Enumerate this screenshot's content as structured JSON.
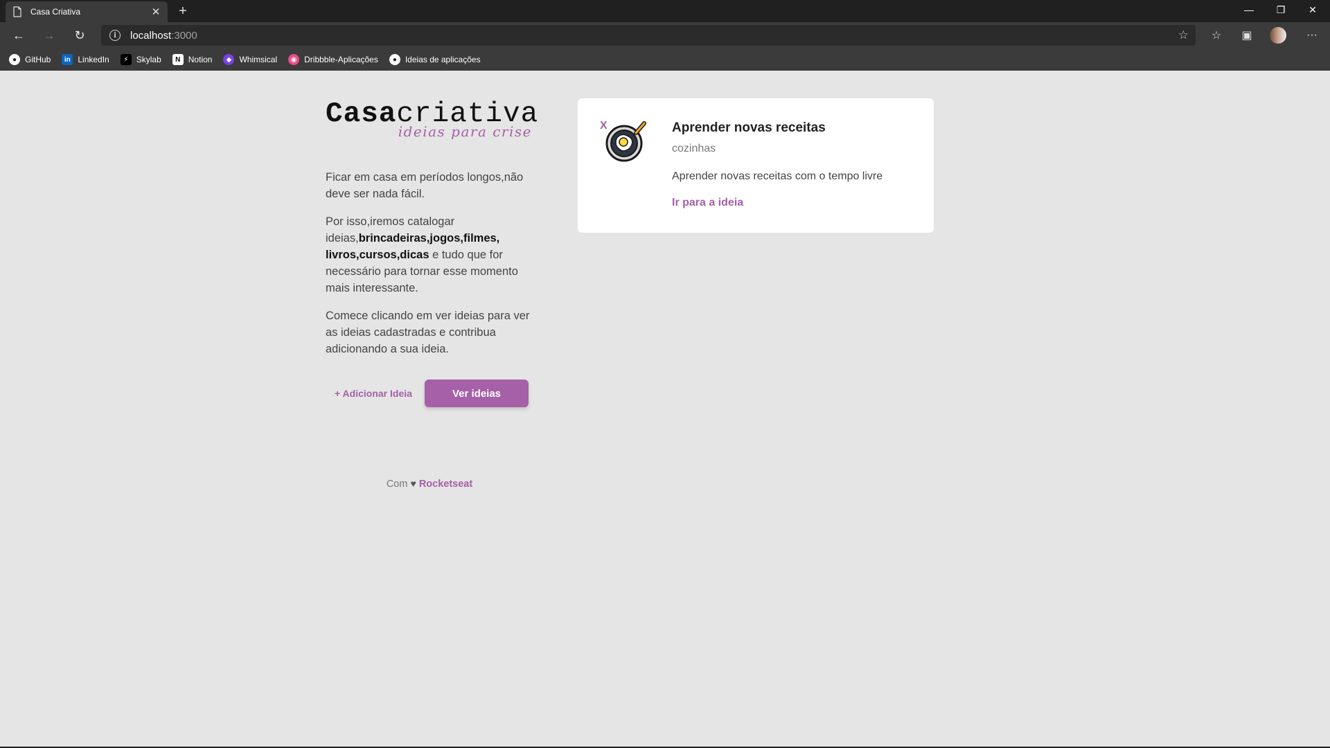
{
  "browser": {
    "tab_title": "Casa Criativa",
    "url_host": "localhost",
    "url_port": ":3000",
    "bookmarks": [
      {
        "label": "GitHub",
        "icon": "github-icon"
      },
      {
        "label": "LinkedIn",
        "icon": "linkedin-icon"
      },
      {
        "label": "Skylab",
        "icon": "skylab-icon"
      },
      {
        "label": "Notion",
        "icon": "notion-icon"
      },
      {
        "label": "Whimsical",
        "icon": "whimsical-icon"
      },
      {
        "label": "Dribbble-Aplicações",
        "icon": "dribbble-icon"
      },
      {
        "label": "Ideias de aplicações",
        "icon": "github-icon"
      }
    ]
  },
  "logo": {
    "bold": "Casa",
    "light": "criativa",
    "tagline": "ideias para crise"
  },
  "intro": {
    "p1": "Ficar em casa em períodos longos,não deve ser nada fácil.",
    "p2_start": "Por isso,iremos catalogar ideias,",
    "p2_bold": "brincadeiras,jogos,filmes, livros,cursos,dicas",
    "p2_end": " e tudo que for necessário para tornar esse momento mais interessante.",
    "p3": "Comece clicando em ver ideias para ver as ideias cadastradas e contribua adicionando a sua ideia."
  },
  "actions": {
    "add_label": "+ Adicionar Ideia",
    "view_label": "Ver ideias"
  },
  "footer": {
    "prefix": "Com",
    "heart": "♥",
    "brand": "Rocketseat"
  },
  "idea": {
    "remove_label": "X",
    "icon": "frying-pan-egg-icon",
    "title": "Aprender novas receitas",
    "category": "cozinhas",
    "description": "Aprender novas receitas com o tempo livre",
    "link_label": "Ir para a ideia"
  },
  "colors": {
    "accent": "#a560a8",
    "page_bg": "#e5e5e5"
  }
}
